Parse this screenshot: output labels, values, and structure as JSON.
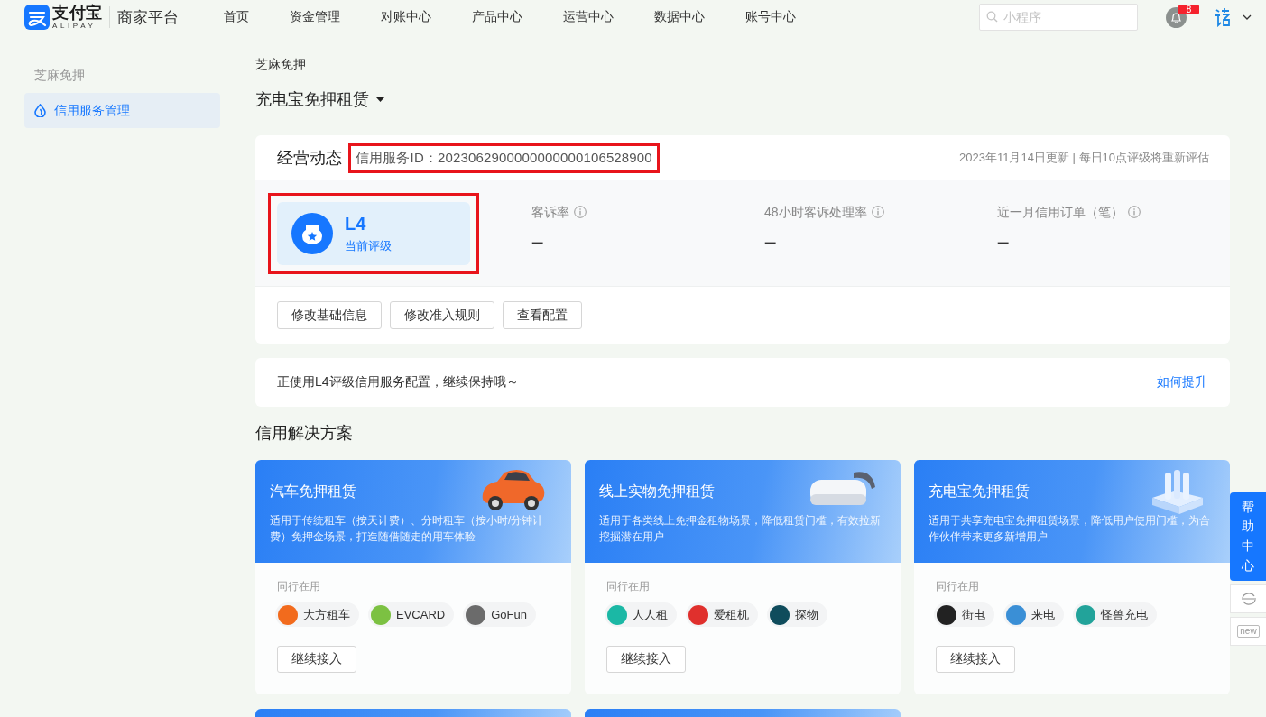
{
  "header": {
    "logo_title": "支付宝",
    "logo_subtitle": "ALIPAY",
    "platform": "商家平台",
    "nav": [
      {
        "label": "首页"
      },
      {
        "label": "资金管理"
      },
      {
        "label": "对账中心"
      },
      {
        "label": "产品中心"
      },
      {
        "label": "运营中心"
      },
      {
        "label": "数据中心"
      },
      {
        "label": "账号中心"
      }
    ],
    "search": {
      "placeholder": "小程序"
    },
    "notifications": {
      "count": "8"
    }
  },
  "sidebar": {
    "group": "芝麻免押",
    "items": [
      {
        "label": "信用服务管理",
        "selected": true
      }
    ]
  },
  "breadcrumb": "芝麻免押",
  "page_title": "充电宝免押租赁",
  "overview": {
    "title": "经营动态",
    "service_id": "信用服务ID：2023062900000000000106528900",
    "update_note": "2023年11月14日更新 | 每日10点评级将重新评估",
    "rating": {
      "level": "L4",
      "caption": "当前评级"
    },
    "metrics": [
      {
        "label": "客诉率",
        "value": "–"
      },
      {
        "label": "48小时客诉处理率",
        "value": "–"
      },
      {
        "label": "近一月信用订单（笔）",
        "value": "–"
      }
    ],
    "buttons": [
      "修改基础信息",
      "修改准入规则",
      "查看配置"
    ]
  },
  "notice": {
    "text": "正使用L4评级信用服务配置，继续保持哦～",
    "link": "如何提升"
  },
  "solutions": {
    "title": "信用解决方案",
    "cards": [
      {
        "kind": "car",
        "title": "汽车免押租赁",
        "description": "适用于传统租车（按天计费）、分时租车（按小时/分钟计费）免押金场景，打造随借随走的用车体验",
        "peers_label": "同行在用",
        "peers": [
          {
            "name": "大方租车",
            "color": "#f26b1d"
          },
          {
            "name": "EVCARD",
            "color": "#7cc142"
          },
          {
            "name": "GoFun",
            "color": "#6b6b6b"
          }
        ],
        "button": "继续接入"
      },
      {
        "kind": "headset",
        "title": "线上实物免押租赁",
        "description": "适用于各类线上免押金租物场景，降低租赁门槛，有效拉新挖掘潜在用户",
        "peers_label": "同行在用",
        "peers": [
          {
            "name": "人人租",
            "color": "#1bb8a5"
          },
          {
            "name": "爱租机",
            "color": "#e0302d"
          },
          {
            "name": "探物",
            "color": "#0f4c5c"
          }
        ],
        "button": "继续接入"
      },
      {
        "kind": "power_bank",
        "title": "充电宝免押租赁",
        "description": "适用于共享充电宝免押租赁场景，降低用户使用门槛，为合作伙伴带来更多新增用户",
        "peers_label": "同行在用",
        "peers": [
          {
            "name": "街电",
            "color": "#222222"
          },
          {
            "name": "来电",
            "color": "#3a8fd6"
          },
          {
            "name": "怪兽充电",
            "color": "#22a39a"
          }
        ],
        "button": "继续接入"
      }
    ]
  },
  "help": {
    "label": "帮助中心",
    "new_label": "new"
  }
}
